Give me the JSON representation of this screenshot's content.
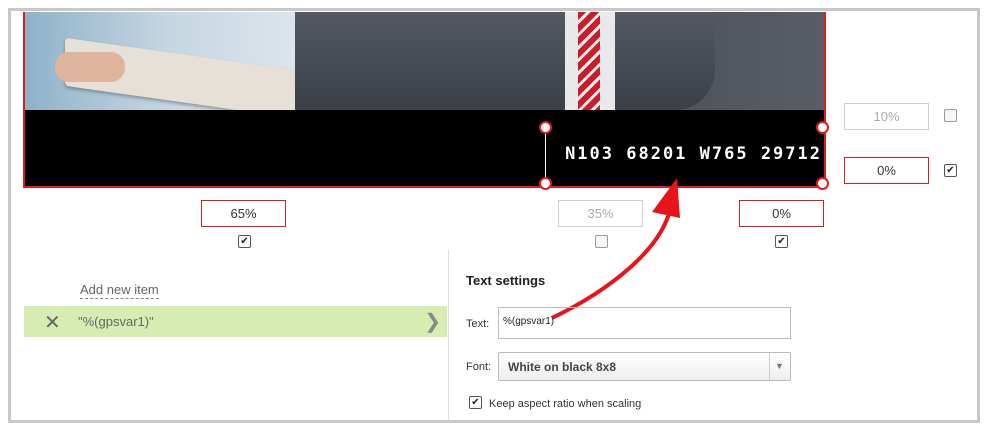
{
  "preview": {
    "overlay_text": "N103 68201 W765 29712"
  },
  "margins": {
    "right_top": {
      "value": "10%",
      "checked": false
    },
    "right_bottom": {
      "value": "0%",
      "checked": true
    },
    "bottom_left": {
      "value": "65%",
      "checked": true
    },
    "bottom_middle": {
      "value": "35%",
      "checked": false
    },
    "bottom_right": {
      "value": "0%",
      "checked": true
    }
  },
  "items_panel": {
    "add_new_item": "Add new item",
    "items": [
      {
        "label": "\"%(gpsvar1)\""
      }
    ]
  },
  "text_settings": {
    "heading": "Text settings",
    "text_label": "Text:",
    "text_value": "%(gpsvar1)",
    "font_label": "Font:",
    "font_value": "White on black 8x8",
    "keep_aspect_label": "Keep aspect ratio when scaling",
    "keep_aspect_checked": true
  },
  "colors": {
    "accent_red": "#e21a1a",
    "item_highlight": "#d6ecb0"
  },
  "icons": {
    "delete": "close-icon",
    "expand": "chevron-right-icon",
    "dropdown": "triangle-down-icon",
    "checkmark": "check-icon"
  }
}
